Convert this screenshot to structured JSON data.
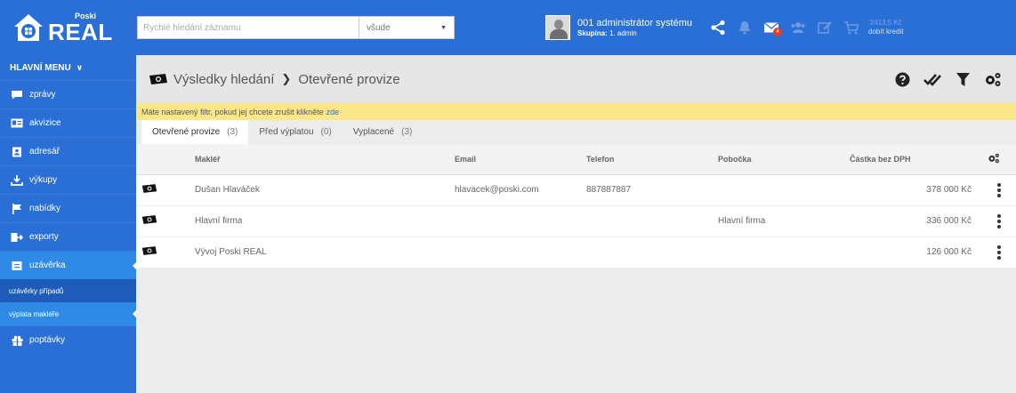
{
  "brand": {
    "small": "Poski",
    "big": "REAL"
  },
  "search": {
    "placeholder": "Rychlé hledání záznamu",
    "scope": "všude"
  },
  "user": {
    "name": "001 administrátor systému",
    "group_label": "Skupina:",
    "group_value": "1. admin"
  },
  "notifications": {
    "mail_count": "4"
  },
  "credit": {
    "amount": "2413,5 Kč",
    "label": "dobít kredit"
  },
  "sidebar": {
    "title": "HLAVNÍ MENU",
    "items": [
      {
        "label": "zprávy",
        "icon": "chat-icon"
      },
      {
        "label": "akvizice",
        "icon": "id-card-icon"
      },
      {
        "label": "adresář",
        "icon": "address-book-icon"
      },
      {
        "label": "výkupy",
        "icon": "download-icon"
      },
      {
        "label": "nabídky",
        "icon": "flag-icon"
      },
      {
        "label": "exporty",
        "icon": "export-icon"
      },
      {
        "label": "uzávěrka",
        "icon": "folder-icon",
        "active": true
      }
    ],
    "subitems": [
      {
        "label": "uzávěrky případů"
      },
      {
        "label": "výplata makléře",
        "active": true
      }
    ],
    "last_item": {
      "label": "poptávky",
      "icon": "gift-icon"
    }
  },
  "header": {
    "crumb1": "Výsledky hledání",
    "crumb2": "Otevřené provize"
  },
  "filter_note": {
    "text": "Máte nastavený filtr, pokud jej chcete zrušit klikněte",
    "link": "zde"
  },
  "tabs": [
    {
      "label": "Otevřené provize",
      "count": "(3)",
      "active": true
    },
    {
      "label": "Před výplatou",
      "count": "(0)"
    },
    {
      "label": "Vyplacené",
      "count": "(3)"
    }
  ],
  "table": {
    "columns": [
      "Makléř",
      "Email",
      "Telefon",
      "Pobočka",
      "Částka bez DPH"
    ],
    "rows": [
      {
        "broker": "Dušan Hlaváček",
        "email": "hlavacek@poski.com",
        "phone": "887887887",
        "branch": "",
        "amount": "378 000 Kč"
      },
      {
        "broker": "Hlavní firma",
        "email": "",
        "phone": "",
        "branch": "Hlavní firma",
        "amount": "336 000 Kč"
      },
      {
        "broker": "Vývoj Poski REAL",
        "email": "",
        "phone": "",
        "branch": "",
        "amount": "126 000 Kč"
      }
    ]
  },
  "colors": {
    "primary": "#2a6fd6",
    "active": "#2f8ae5",
    "note": "#fbe78a"
  }
}
